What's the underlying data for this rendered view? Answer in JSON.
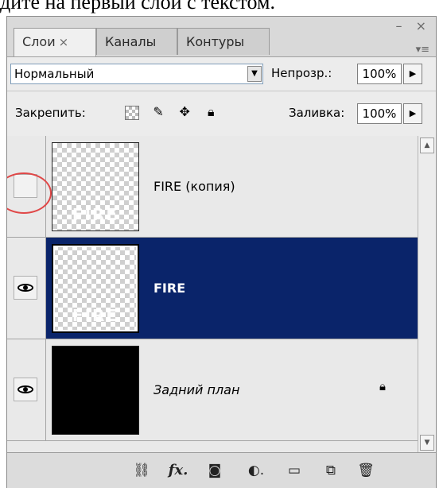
{
  "caption": "дите на первый слой с текстом.",
  "panel": {
    "tabs": [
      {
        "label": "Слои",
        "close": "×"
      },
      {
        "label": "Каналы"
      },
      {
        "label": "Контуры"
      }
    ],
    "window_controls": "– ×",
    "menu_icon": "▾≡"
  },
  "blend": {
    "mode": "Нормальный",
    "opacity_label": "Непрозр.:",
    "opacity_value": "100%"
  },
  "lock": {
    "label": "Закрепить:",
    "fill_label": "Заливка:",
    "fill_value": "100%",
    "icons": [
      "checker-lock-icon",
      "brush-lock-icon",
      "move-lock-icon",
      "padlock-icon"
    ]
  },
  "layers": [
    {
      "name": "FIRE (копия)",
      "visible": false,
      "selected": false,
      "thumb": "transparent",
      "thumb_text": "FIRE"
    },
    {
      "name": "FIRE",
      "visible": true,
      "selected": true,
      "thumb": "transparent",
      "thumb_text": "FIRE"
    },
    {
      "name": "Задний план",
      "visible": true,
      "selected": false,
      "thumb": "black",
      "locked": true
    }
  ],
  "colors": {
    "selection": "#0a246a",
    "annotation_circle": "#e04848"
  },
  "bottom_tools": [
    "link-icon",
    "fx-icon",
    "mask-icon",
    "adjustment-icon",
    "folder-icon",
    "new-layer-icon",
    "trash-icon"
  ],
  "fx_label": "fx"
}
